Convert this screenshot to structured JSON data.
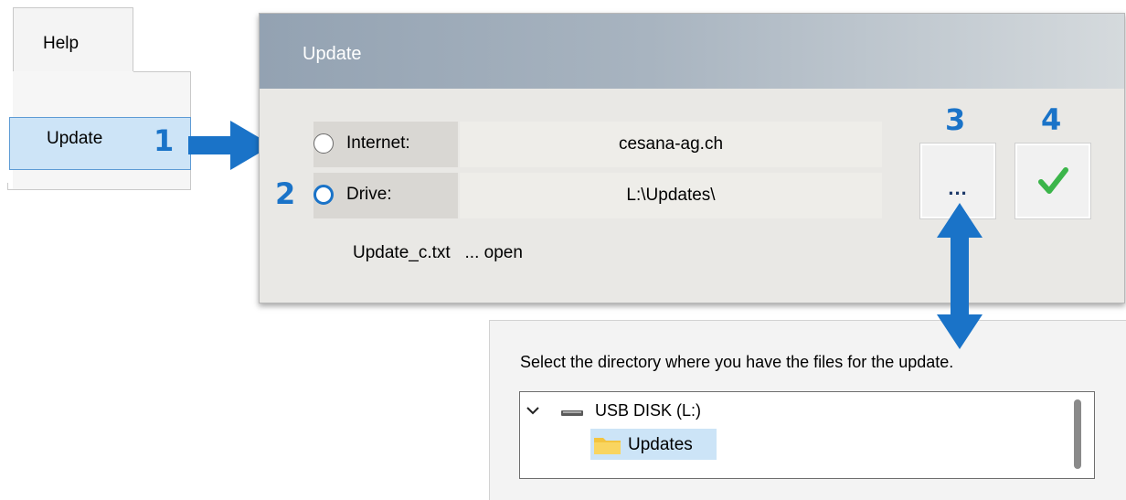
{
  "menu": {
    "help_tab": "Help",
    "update_item": "Update"
  },
  "markers": [
    "1",
    "2",
    "3",
    "4"
  ],
  "dialog": {
    "title": "Update",
    "source_options": [
      {
        "label": "Internet:",
        "value": "cesana-ag.ch",
        "selected": false
      },
      {
        "label": "Drive:",
        "value": "L:\\Updates\\",
        "selected": true
      }
    ],
    "file_name": "Update_c.txt",
    "file_action": "... open",
    "browse_label": "...",
    "confirm_icon": "checkmark-icon"
  },
  "folder_dialog": {
    "instruction": "Select the directory where you have the files for the update.",
    "drive": "USB DISK (L:)",
    "folder": "Updates"
  },
  "colors": {
    "marker": "#1a73c8",
    "arrow": "#1a73c8",
    "check": "#3bb54a",
    "selection": "#cde4f7"
  }
}
